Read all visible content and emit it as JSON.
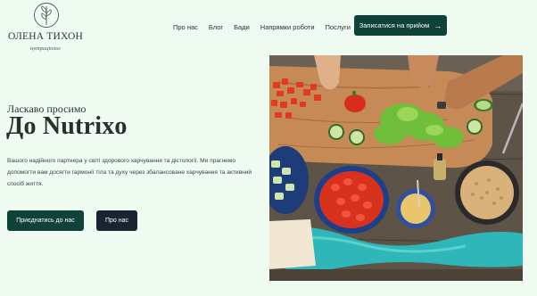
{
  "logo": {
    "name": "ОЛЕНА ТИХОН",
    "subtitle": "нутриціолог"
  },
  "nav": {
    "items": [
      "Про нас",
      "Блог",
      "Бади",
      "Напрямки роботи",
      "Послуги"
    ]
  },
  "header_cta": {
    "label": "Записатися на прийом",
    "icon": "arrow-right-icon"
  },
  "hero": {
    "kicker": "Ласкаво просимо",
    "title": "До Nutrixo",
    "description": "Вашого надійного партнера у світі здорового харчування та дієтології. Ми прагнемо допомогти вам досягти гармонії тіла та духу через збалансоване харчування та активний спосіб життя.",
    "primary_button": "Приєднатись до нас",
    "secondary_button": "Про нас"
  },
  "colors": {
    "background": "#effaf0",
    "primary": "#0f4238",
    "secondary_button": "#1a2430"
  }
}
